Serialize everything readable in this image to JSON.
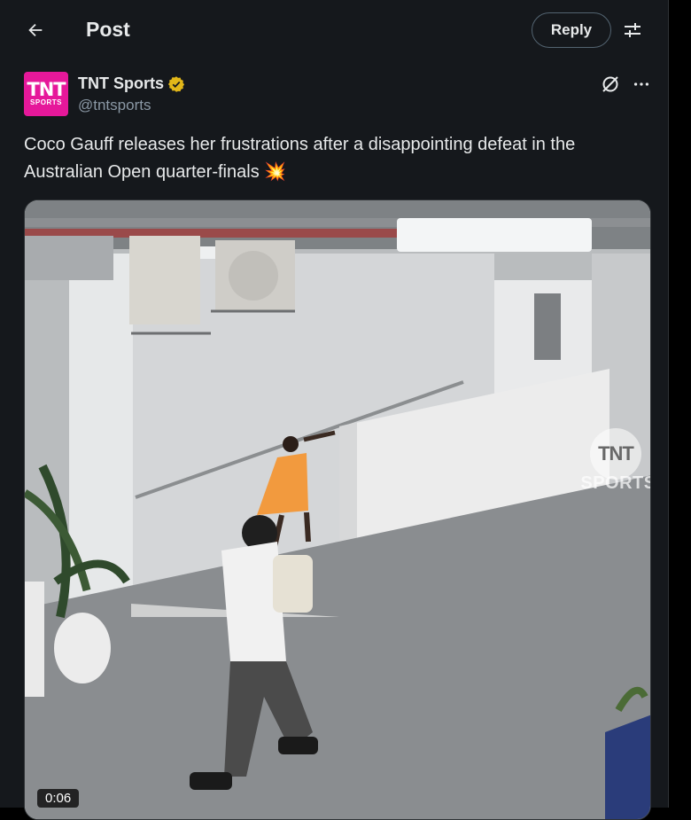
{
  "header": {
    "title": "Post",
    "reply_label": "Reply"
  },
  "author": {
    "avatar_line1": "TNT",
    "avatar_line2": "SPORTS",
    "name": "TNT Sports",
    "handle": "@tntsports",
    "verified_color": "#e2b719"
  },
  "post": {
    "text": "Coco Gauff releases her frustrations after a disappointing defeat in the Australian Open quarter-finals 💥"
  },
  "video": {
    "duration": "0:06",
    "watermark_line1": "TNT",
    "watermark_line2": "SPORTS"
  },
  "icons": [
    "arrow-left-icon",
    "sliders-icon",
    "verified-badge-icon",
    "grok-icon",
    "more-horizontal-icon"
  ],
  "colors": {
    "accent": "#e6189a",
    "background": "#15181c",
    "text": "#e7e9ea",
    "muted": "#8b98a5"
  }
}
